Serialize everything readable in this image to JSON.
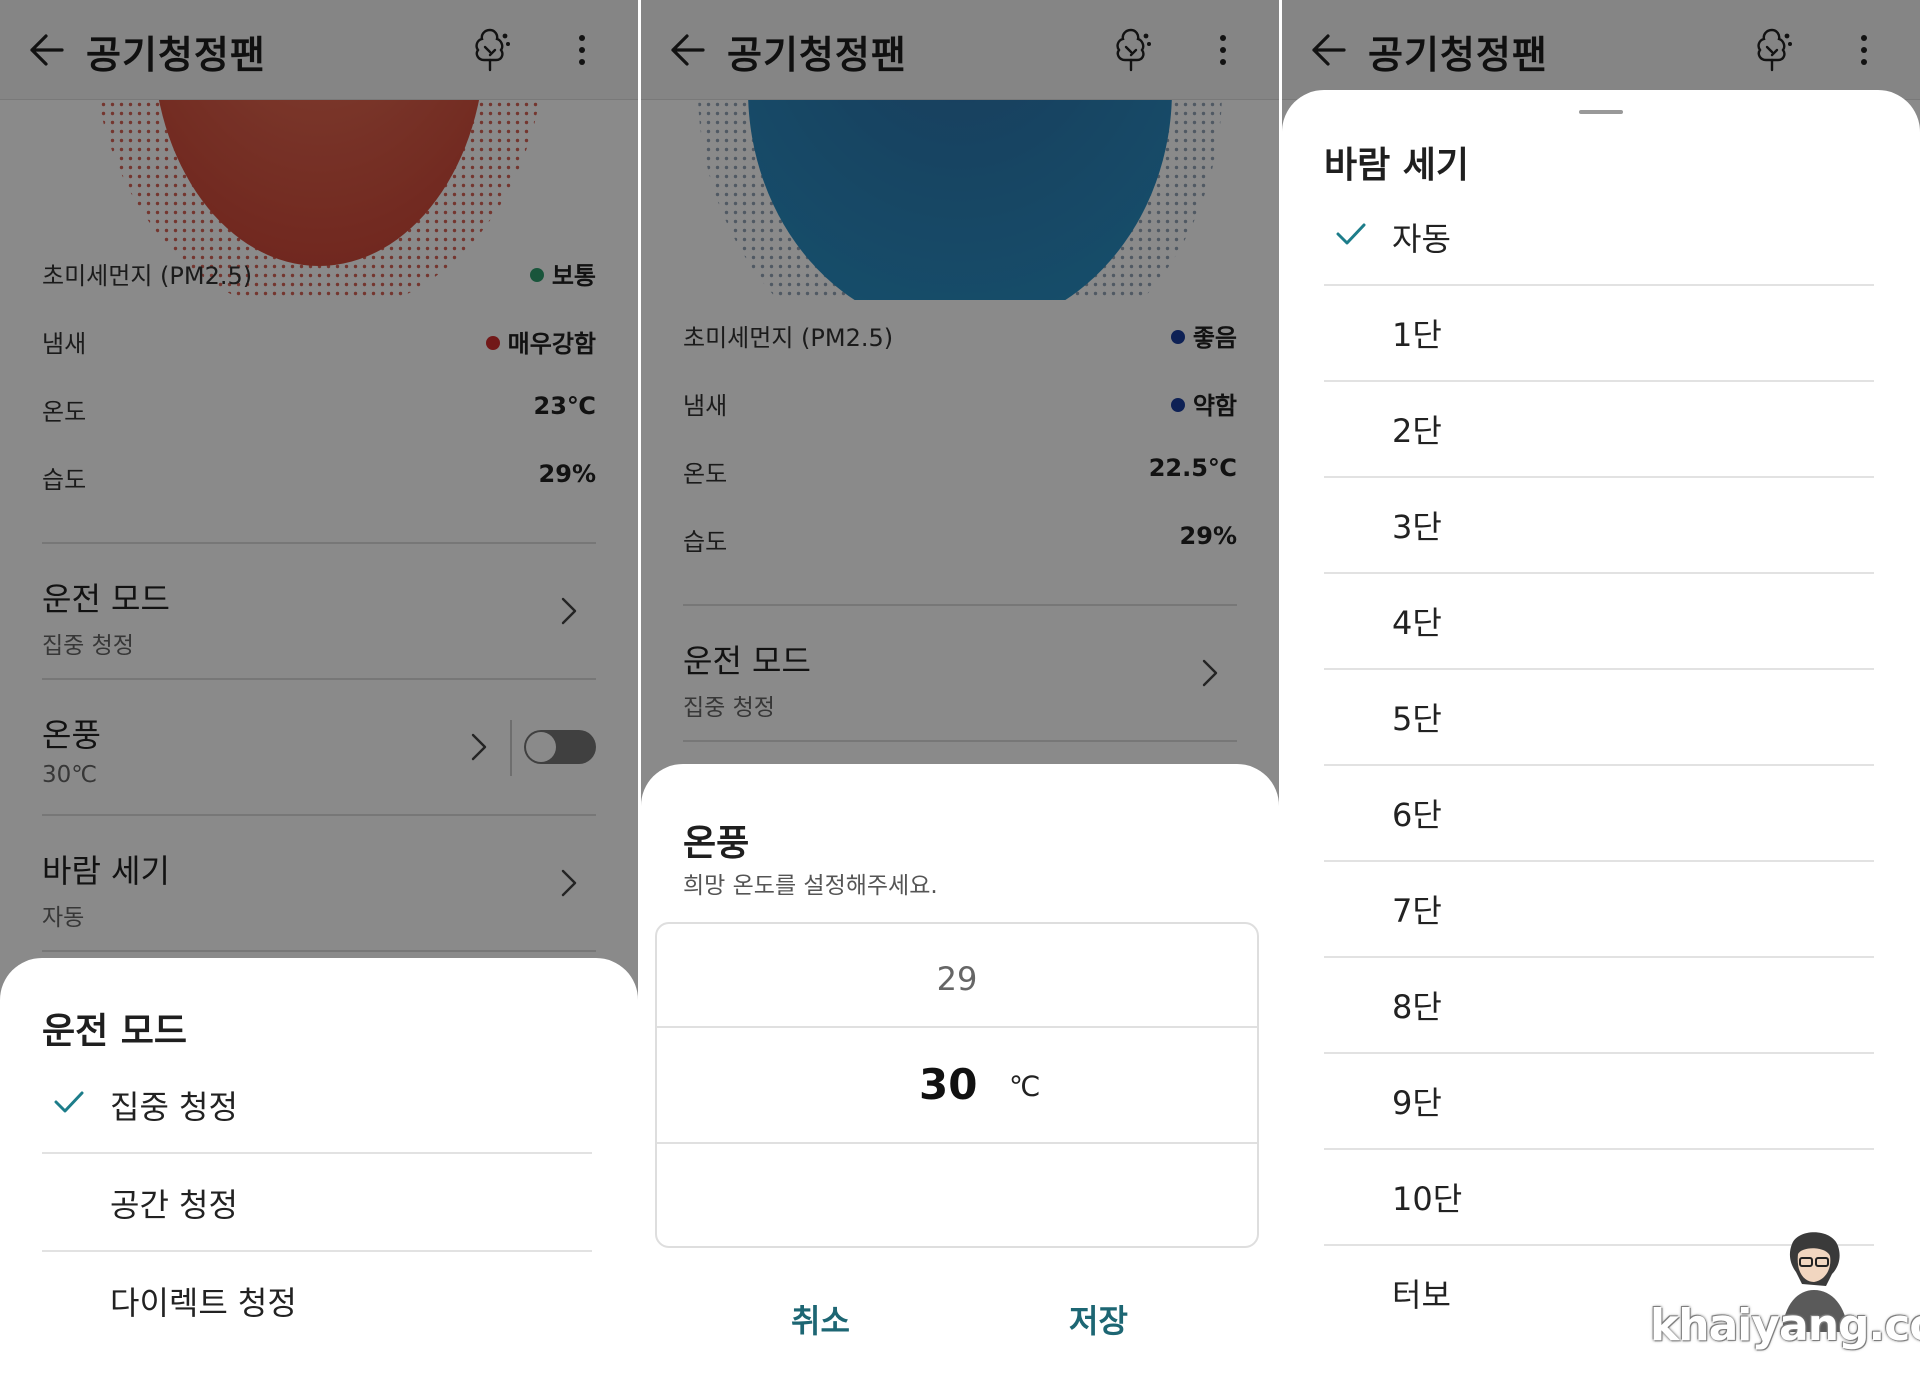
{
  "app": {
    "title": "공기청정팬"
  },
  "screen1": {
    "air": [
      {
        "label": "초미세먼지 (PM2.5)",
        "value": "보통",
        "dot": "#2f9e6e"
      },
      {
        "label": "냄새",
        "value": "매우강함",
        "dot": "#d32f2f"
      },
      {
        "label": "온도",
        "value": "23℃"
      },
      {
        "label": "습도",
        "value": "29%"
      }
    ],
    "settings": [
      {
        "title": "운전 모드",
        "sub": "집중 청정"
      },
      {
        "title": "온풍",
        "sub": "30℃",
        "toggle": false
      },
      {
        "title": "바람 세기",
        "sub": "자동"
      }
    ],
    "sheet": {
      "title": "운전 모드",
      "selected": "집중 청정",
      "options": [
        "집중 청정",
        "공간 청정",
        "다이렉트 청정"
      ]
    },
    "circle_color": "#d04a3a"
  },
  "screen2": {
    "air": [
      {
        "label": "초미세먼지 (PM2.5)",
        "value": "좋음",
        "dot": "#1a3d9e"
      },
      {
        "label": "냄새",
        "value": "약함",
        "dot": "#1a3d9e"
      },
      {
        "label": "온도",
        "value": "22.5℃"
      },
      {
        "label": "습도",
        "value": "29%"
      }
    ],
    "settings": [
      {
        "title": "운전 모드",
        "sub": "집중 청정"
      }
    ],
    "sheet": {
      "title": "온풍",
      "subtitle": "희망 온도를 설정해주세요.",
      "picker_prev": "29",
      "picker_current": "30",
      "picker_unit": "℃",
      "cancel": "취소",
      "save": "저장"
    },
    "circle_color": "#1f7fb4"
  },
  "screen3": {
    "sheet": {
      "title": "바람 세기",
      "selected": "자동",
      "options": [
        "자동",
        "1단",
        "2단",
        "3단",
        "4단",
        "5단",
        "6단",
        "7단",
        "8단",
        "9단",
        "10단",
        "터보"
      ]
    }
  },
  "colors": {
    "accent": "#1d6673",
    "check": "#1d7d8a"
  },
  "watermark": "khaiyang.com"
}
